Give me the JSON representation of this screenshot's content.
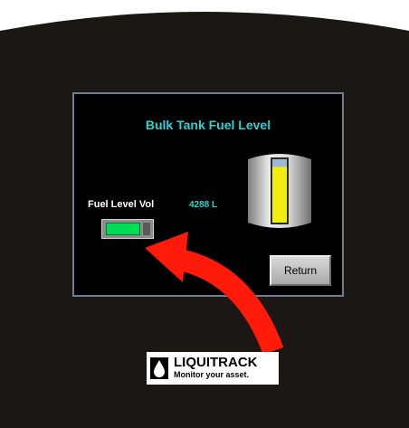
{
  "screen": {
    "title": "Bulk Tank Fuel Level",
    "fuel_label": "Fuel Level Vol",
    "fuel_value": "4288 L",
    "fuel_fraction": 0.88,
    "return_label": "Return"
  },
  "brand": {
    "name": "LIQUITRACK",
    "tagline": "Monitor your asset."
  },
  "colors": {
    "screen_bg": "#000000",
    "title": "#2ad4d4",
    "indicator": "#00dd55",
    "tank_fuel": "#f2ee10",
    "arrow": "#ff1a0a"
  },
  "icons": [
    "fuel-drop-icon",
    "pointer-arrow-icon"
  ]
}
